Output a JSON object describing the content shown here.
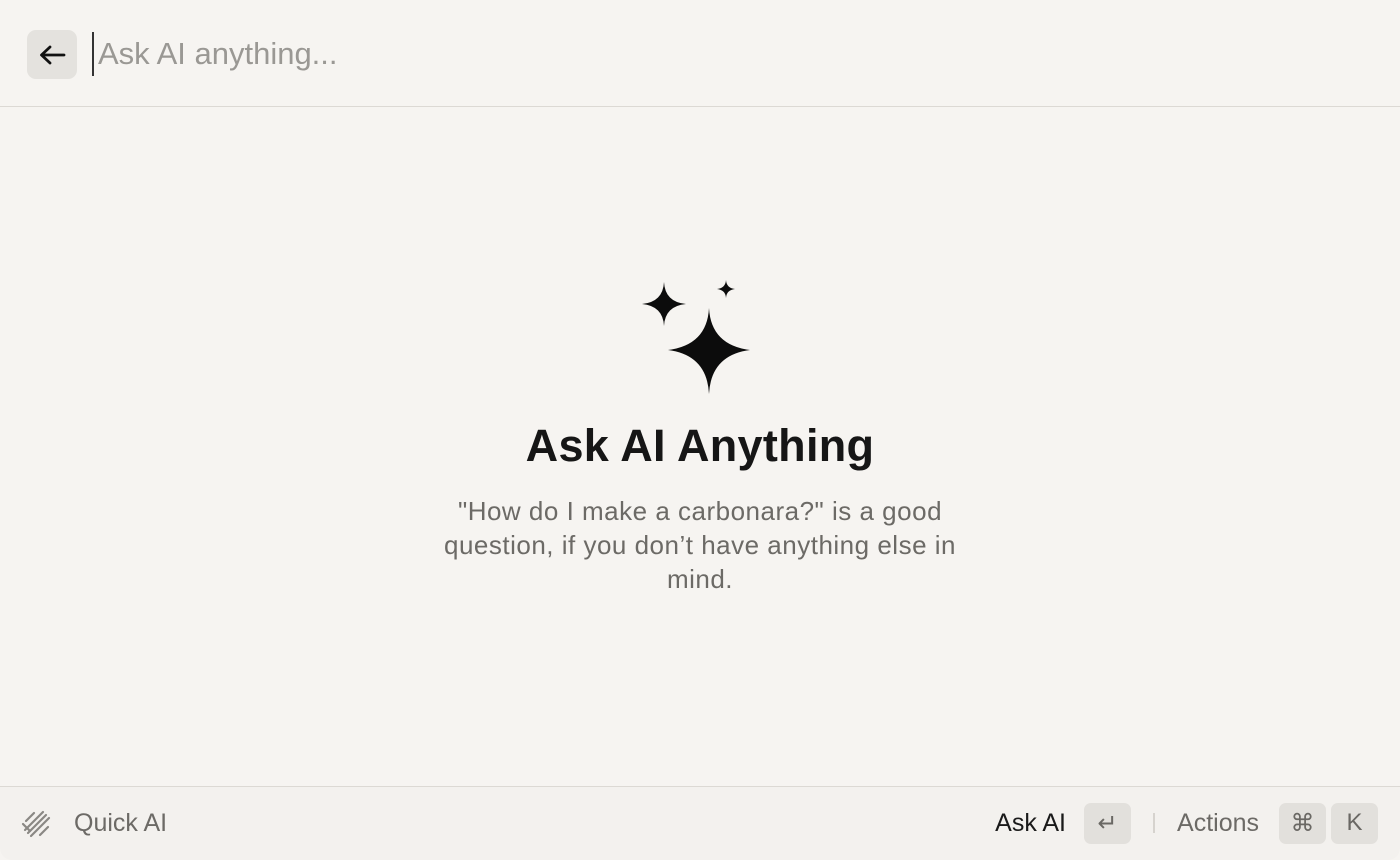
{
  "header": {
    "back_label": "←",
    "search_placeholder": "Ask AI anything..."
  },
  "empty_state": {
    "icon": "sparkles-icon",
    "title": "Ask AI Anything",
    "subtitle": "\"How do I make a carbonara?\" is a good question, if you don’t have anything else in mind."
  },
  "footer": {
    "icon": "quick-ai-icon",
    "label": "Quick AI",
    "primary_action": "Ask AI",
    "primary_shortcut": "↵",
    "secondary_action": "Actions",
    "shortcut_modifier": "⌘",
    "shortcut_key": "K"
  },
  "colors": {
    "background": "#f6f4f1",
    "key_bg": "#e2e0dc",
    "muted_text": "#6c6a66",
    "title_text": "#161616"
  }
}
